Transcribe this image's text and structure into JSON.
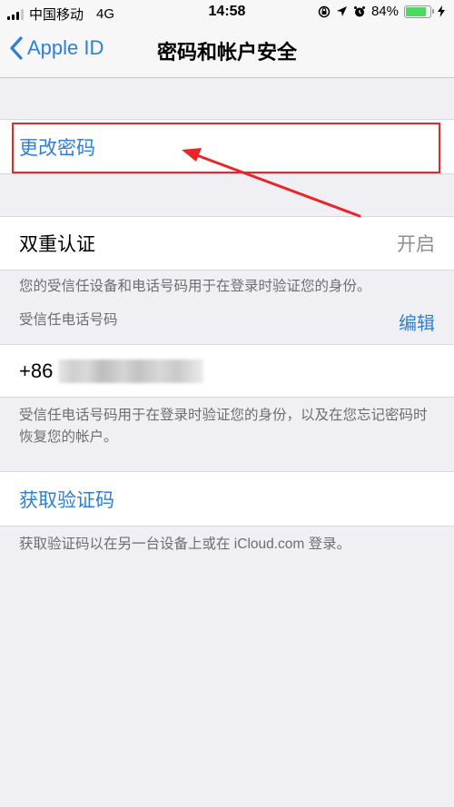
{
  "status_bar": {
    "carrier": "中国移动",
    "network": "4G",
    "time": "14:58",
    "battery_percent_label": "84%",
    "battery_level": 0.84,
    "icons": [
      "signal-icon",
      "orientation-lock-icon",
      "location-icon",
      "alarm-icon",
      "battery-icon",
      "charging-icon"
    ]
  },
  "nav": {
    "back_label": "Apple ID",
    "title": "密码和帐户安全"
  },
  "sections": {
    "change_password": {
      "label": "更改密码"
    },
    "two_factor": {
      "label": "双重认证",
      "value": "开启",
      "footer": "您的受信任设备和电话号码用于在登录时验证您的身份。"
    },
    "trusted_numbers": {
      "header": "受信任电话号码",
      "edit_label": "编辑",
      "phone_prefix": "+86",
      "footer": "受信任电话号码用于在登录时验证您的身份，以及在您忘记密码时恢复您的帐户。"
    },
    "verification_code": {
      "label": "获取验证码",
      "footer": "获取验证码以在另一台设备上或在 iCloud.com 登录。"
    }
  },
  "annotation": {
    "color": "#e8262a",
    "target": "更改密码"
  },
  "colors": {
    "link_blue": "#2d7fd6",
    "background": "#efeff4",
    "battery_green": "#4cd964"
  }
}
